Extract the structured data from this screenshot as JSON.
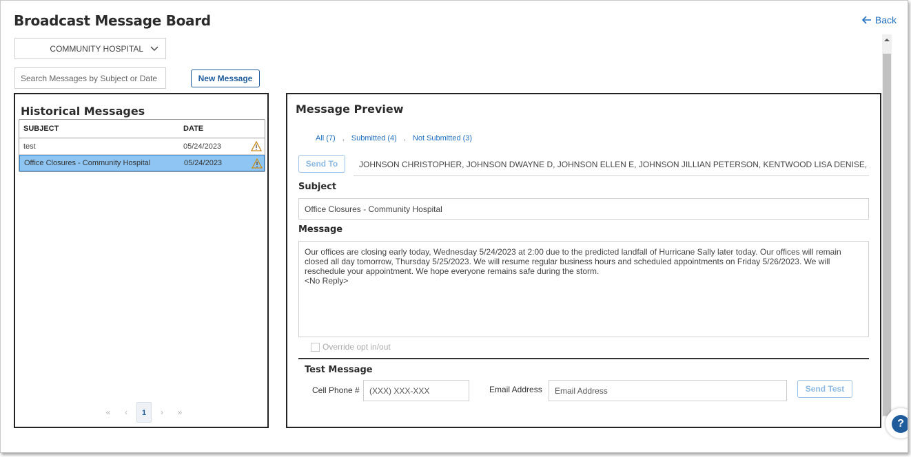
{
  "header": {
    "title": "Broadcast Message Board",
    "back_label": "Back"
  },
  "facility": {
    "selected": "COMMUNITY HOSPITAL"
  },
  "search": {
    "placeholder": "Search Messages by Subject or Date"
  },
  "toolbar": {
    "new_message_label": "New Message"
  },
  "history": {
    "title": "Historical Messages",
    "columns": {
      "subject": "SUBJECT",
      "date": "DATE"
    },
    "rows": [
      {
        "subject": "test",
        "date": "05/24/2023",
        "icon": "warning-icon"
      },
      {
        "subject": "Office Closures - Community Hospital",
        "date": "05/24/2023",
        "icon": "warning-icon"
      }
    ],
    "pager": {
      "first": "«",
      "prev": "‹",
      "current": "1",
      "next": "›",
      "last": "»"
    }
  },
  "preview": {
    "title": "Message Preview",
    "filters": {
      "all": "All (7)",
      "submitted": "Submitted (4)",
      "not_submitted": "Not Submitted (3)",
      "separator": "."
    },
    "send_to_label": "Send To",
    "recipients": "JOHNSON CHRISTOPHER, JOHNSON DWAYNE D, JOHNSON ELLEN E, JOHNSON JILLIAN PETERSON, KENTWOOD LISA DENISE, REED GR...",
    "subject_label": "Subject",
    "subject_value": "Office Closures - Community Hospital",
    "message_label": "Message",
    "message_value": "Our offices are closing early today, Wednesday 5/24/2023 at 2:00 due to the predicted landfall of Hurricane Sally later today. Our offices will remain closed all day tomorrow, Thursday 5/25/2023. We will resume regular business hours and scheduled appointments on Friday 5/26/2023. We will reschedule your appointment. We hope everyone remains safe during the storm.\n<No Reply>",
    "override_label": "Override opt in/out"
  },
  "test_message": {
    "title": "Test Message",
    "cell_label": "Cell Phone #",
    "cell_placeholder": "(XXX) XXX-XXX",
    "email_label": "Email Address",
    "email_placeholder": "Email Address",
    "send_test_label": "Send Test"
  },
  "help": {
    "label": "?"
  },
  "colors": {
    "accent": "#1f5c9c",
    "link": "#1f6fbf",
    "selected_row": "#8ec5f2",
    "warning": "#c98a1a"
  }
}
